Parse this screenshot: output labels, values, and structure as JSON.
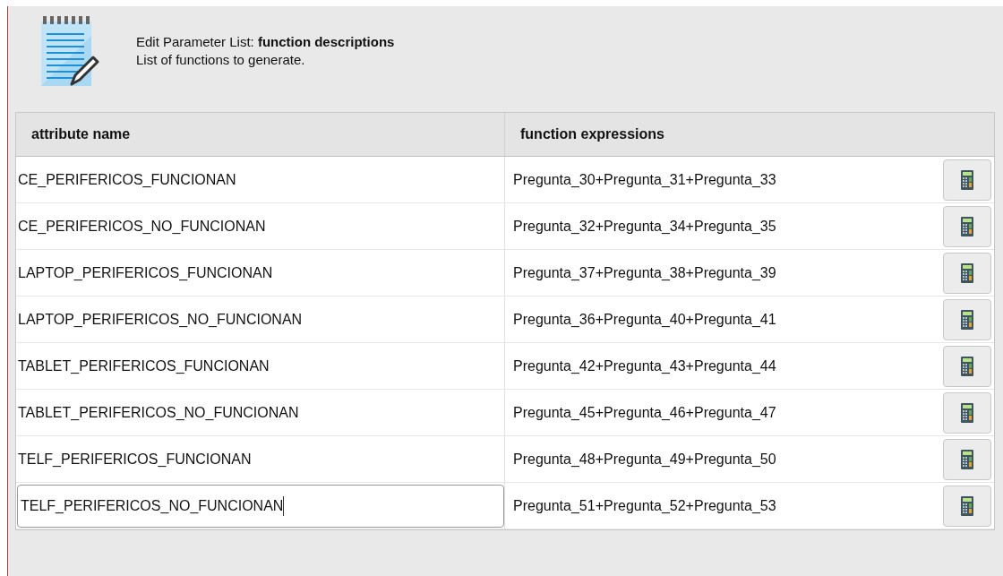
{
  "header": {
    "title": "Edit Parameter List: **function descriptions**",
    "description": "List of functions to generate."
  },
  "table": {
    "columns": [
      "attribute name",
      "function expressions"
    ],
    "rows": [
      {
        "attribute": "CE_PERIFERICOS_FUNCIONAN",
        "expression": "Pregunta_30+Pregunta_31+Pregunta_33",
        "editing": false
      },
      {
        "attribute": "CE_PERIFERICOS_NO_FUNCIONAN",
        "expression": "Pregunta_32+Pregunta_34+Pregunta_35",
        "editing": false
      },
      {
        "attribute": "LAPTOP_PERIFERICOS_FUNCIONAN",
        "expression": "Pregunta_37+Pregunta_38+Pregunta_39",
        "editing": false
      },
      {
        "attribute": "LAPTOP_PERIFERICOS_NO_FUNCIONAN",
        "expression": "Pregunta_36+Pregunta_40+Pregunta_41",
        "editing": false
      },
      {
        "attribute": "TABLET_PERIFERICOS_FUNCIONAN",
        "expression": "Pregunta_42+Pregunta_43+Pregunta_44",
        "editing": false
      },
      {
        "attribute": "TABLET_PERIFERICOS_NO_FUNCIONAN",
        "expression": "Pregunta_45+Pregunta_46+Pregunta_47",
        "editing": false
      },
      {
        "attribute": "TELF_PERIFERICOS_FUNCIONAN",
        "expression": "Pregunta_48+Pregunta_49+Pregunta_50",
        "editing": false
      },
      {
        "attribute": "TELF_PERIFERICOS_NO_FUNCIONAN",
        "expression": "Pregunta_51+Pregunta_52+Pregunta_53",
        "editing": true
      }
    ]
  }
}
